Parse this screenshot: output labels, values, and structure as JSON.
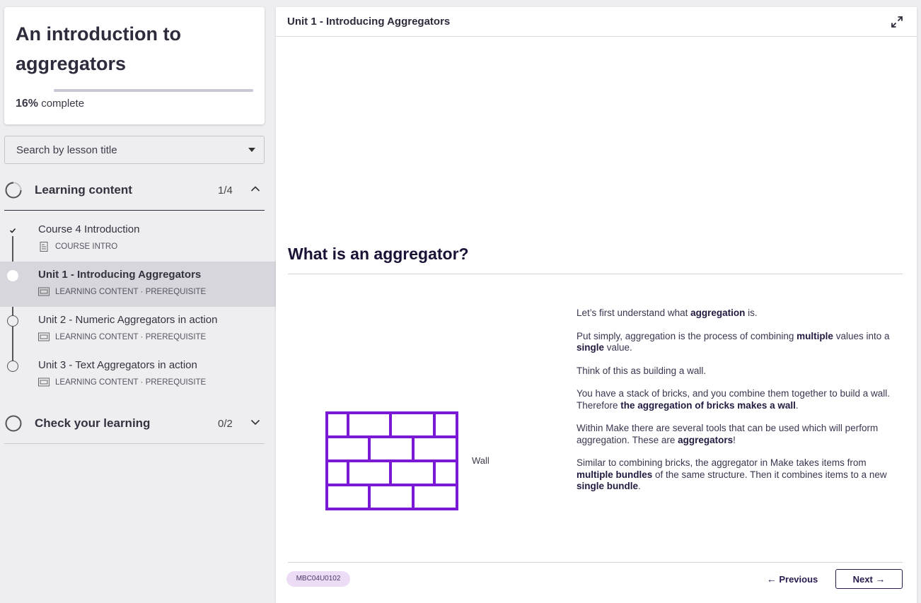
{
  "sidebar": {
    "course_title": "An introduction to aggregators",
    "progress_percent": "16%",
    "progress_suffix": "complete",
    "progress_fraction": 0.16,
    "search_placeholder": "Search by lesson title",
    "sections": [
      {
        "title": "Learning content",
        "count": "1/4",
        "expanded": true,
        "lessons": [
          {
            "title": "Course 4 Introduction",
            "meta": "COURSE INTRO",
            "status": "complete",
            "icon": "document-icon"
          },
          {
            "title": "Unit 1 - Introducing Aggregators",
            "meta": "LEARNING CONTENT · PREREQUISITE",
            "status": "active",
            "icon": "presentation-icon"
          },
          {
            "title": "Unit 2 - Numeric Aggregators in action",
            "meta": "LEARNING CONTENT · PREREQUISITE",
            "status": "incomplete",
            "icon": "presentation-icon"
          },
          {
            "title": "Unit 3 - Text Aggregators in action",
            "meta": "LEARNING CONTENT · PREREQUISITE",
            "status": "incomplete",
            "icon": "presentation-icon"
          }
        ]
      },
      {
        "title": "Check your learning",
        "count": "0/2",
        "expanded": false,
        "lessons": []
      }
    ]
  },
  "main": {
    "header_title": "Unit 1 - Introducing Aggregators",
    "heading": "What is an aggregator?",
    "wall_label": "Wall",
    "wall_color": "#7a18d6",
    "paragraphs": [
      [
        {
          "t": "Let’s first understand what "
        },
        {
          "t": "aggregation",
          "b": true
        },
        {
          "t": " is."
        }
      ],
      [
        {
          "t": "Put simply, aggregation is the process of combining "
        },
        {
          "t": "multiple",
          "b": true
        },
        {
          "t": " values into a "
        },
        {
          "t": "single",
          "b": true
        },
        {
          "t": " value."
        }
      ],
      [
        {
          "t": "Think of this as building a wall."
        }
      ],
      [
        {
          "t": "You have a stack of bricks, and you combine them together to build a wall. Therefore "
        },
        {
          "t": "the aggregation of bricks makes a wall",
          "b": true
        },
        {
          "t": "."
        }
      ],
      [
        {
          "t": "Within Make there are several tools that can be used which will perform aggregation. These are "
        },
        {
          "t": "aggregators",
          "b": true
        },
        {
          "t": "!"
        }
      ],
      [
        {
          "t": "Similar to combining bricks, the aggregator in Make takes items from "
        },
        {
          "t": "multiple bundles",
          "b": true
        },
        {
          "t": " of the same structure. Then it combines items to a new "
        },
        {
          "t": "single bundle",
          "b": true
        },
        {
          "t": "."
        }
      ]
    ],
    "code": "MBC04U0102",
    "previous_label": "Previous",
    "next_label": "Next"
  }
}
